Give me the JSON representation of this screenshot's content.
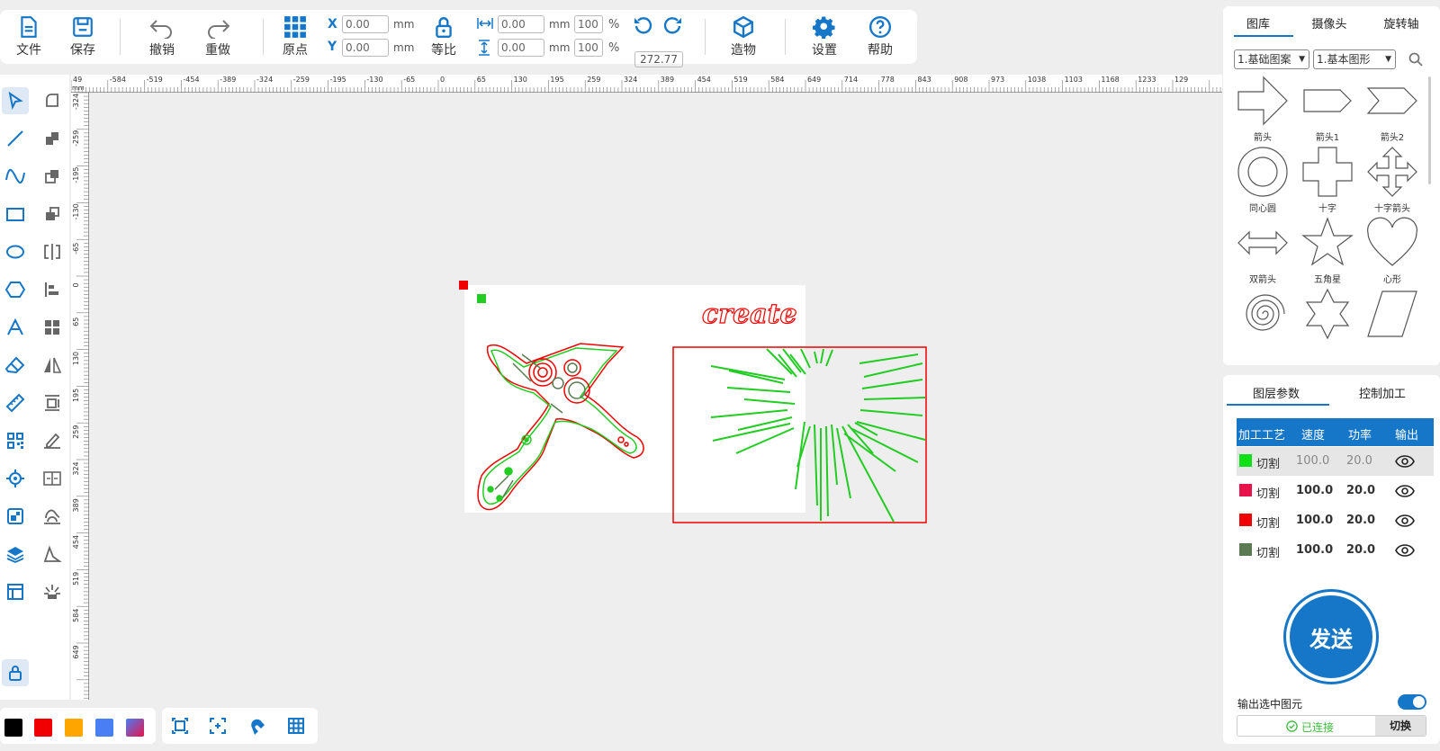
{
  "toolbar": {
    "file": "文件",
    "save": "保存",
    "undo": "撤销",
    "redo": "重做",
    "origin": "原点",
    "x_label": "X",
    "y_label": "Y",
    "x_value": "0.00",
    "y_value": "0.00",
    "unit": "mm",
    "ratio": "等比",
    "width_value": "0.00",
    "height_value": "0.00",
    "width_pct": "100",
    "height_pct": "100",
    "pct": "%",
    "rotation": "272.77",
    "build": "造物",
    "settings": "设置",
    "help": "帮助"
  },
  "ruler": {
    "unit": "mm",
    "h_ticks": [
      "49",
      "-584",
      "-519",
      "-454",
      "-389",
      "-324",
      "-259",
      "-195",
      "-130",
      "-65",
      "0",
      "65",
      "130",
      "195",
      "259",
      "324",
      "389",
      "454",
      "519",
      "584",
      "649",
      "714",
      "778",
      "843",
      "908",
      "973",
      "1038",
      "1103",
      "1168",
      "1233",
      "129"
    ],
    "v_ticks": [
      "-324",
      "-259",
      "-195",
      "-130",
      "-65",
      "0",
      "65",
      "130",
      "195",
      "259",
      "324",
      "389",
      "454",
      "519",
      "584",
      "649"
    ]
  },
  "canvas": {
    "text_create": "create"
  },
  "left_tools": [
    "select-icon",
    "path-edit-icon",
    "line-icon",
    "boolean-union-icon",
    "curve-icon",
    "boolean-subtract-icon",
    "rectangle-icon",
    "boolean-intersect-icon",
    "ellipse-icon",
    "mirror-icon",
    "polygon-icon",
    "align-icon",
    "text-icon",
    "grid-layout-icon",
    "eraser-icon",
    "flip-icon",
    "ruler-icon",
    "array-icon",
    "qrcode-icon",
    "sign-icon",
    "target-icon",
    "split-icon",
    "offset-icon",
    "fill-icon",
    "layers-icon",
    "vector-icon",
    "layout-icon",
    "burst-icon",
    "lock-icon"
  ],
  "colors": [
    "#000000",
    "#f00000",
    "#ffa500",
    "#4a7ef5",
    "gradient"
  ],
  "library": {
    "tabs": [
      "图库",
      "摄像头",
      "旋转轴"
    ],
    "category": "1.基础图案",
    "subcategory": "1.基本图形",
    "shapes": [
      {
        "label": "箭头"
      },
      {
        "label": "箭头1"
      },
      {
        "label": "箭头2"
      },
      {
        "label": "同心圆"
      },
      {
        "label": "十字"
      },
      {
        "label": "十字箭头"
      },
      {
        "label": "双箭头"
      },
      {
        "label": "五角星"
      },
      {
        "label": "心形"
      },
      {
        "label": ""
      },
      {
        "label": ""
      },
      {
        "label": ""
      }
    ]
  },
  "layers": {
    "tabs": [
      "图层参数",
      "控制加工"
    ],
    "headers": [
      "加工工艺",
      "速度",
      "功率",
      "输出"
    ],
    "rows": [
      {
        "color": "#0ee016",
        "process": "切割",
        "speed": "100.0",
        "power": "20.0"
      },
      {
        "color": "#e8134a",
        "process": "切割",
        "speed": "100.0",
        "power": "20.0"
      },
      {
        "color": "#f00000",
        "process": "切割",
        "speed": "100.0",
        "power": "20.0"
      },
      {
        "color": "#5a7a52",
        "process": "切割",
        "speed": "100.0",
        "power": "20.0"
      }
    ],
    "send": "发送",
    "output_selected": "输出选中图元",
    "connected": "已连接",
    "switch": "切换"
  }
}
